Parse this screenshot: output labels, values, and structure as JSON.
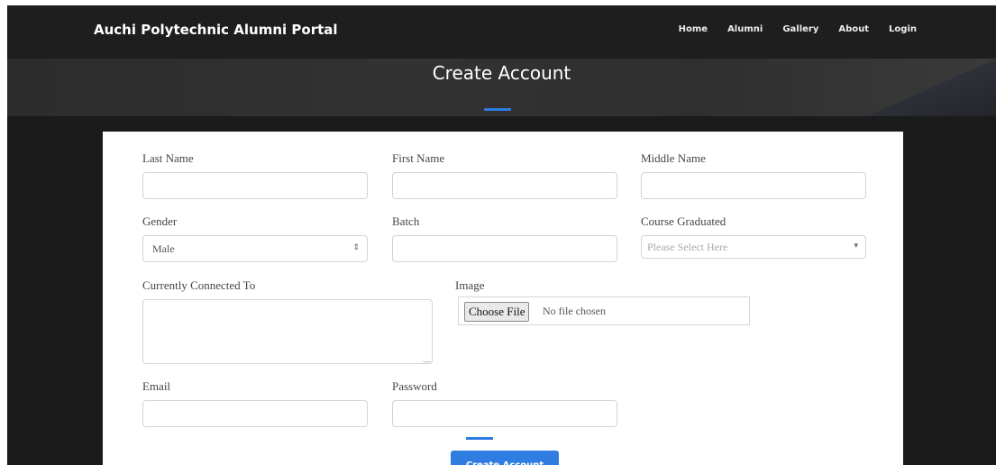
{
  "navbar": {
    "brand": "Auchi Polytechnic Alumni Portal",
    "links": [
      "Home",
      "Alumni",
      "Gallery",
      "About",
      "Login"
    ]
  },
  "header": {
    "title": "Create Account"
  },
  "form": {
    "last_name_label": "Last Name",
    "first_name_label": "First Name",
    "middle_name_label": "Middle Name",
    "gender_label": "Gender",
    "gender_value": "Male",
    "batch_label": "Batch",
    "course_label": "Course Graduated",
    "course_placeholder": "Please Select Here",
    "connected_label": "Currently Connected To",
    "image_label": "Image",
    "file_button": "Choose File",
    "file_status": "No file chosen",
    "email_label": "Email",
    "password_label": "Password",
    "submit_label": "Create Account"
  },
  "colors": {
    "accent": "#2f7de1",
    "nav_bg": "#1e1e1e",
    "card_bg": "#ffffff"
  },
  "icons": {
    "select_caret": "up-down-caret-icon",
    "dropdown_caret": "chevron-down-icon",
    "resize_handle": "resize-grip-icon"
  }
}
